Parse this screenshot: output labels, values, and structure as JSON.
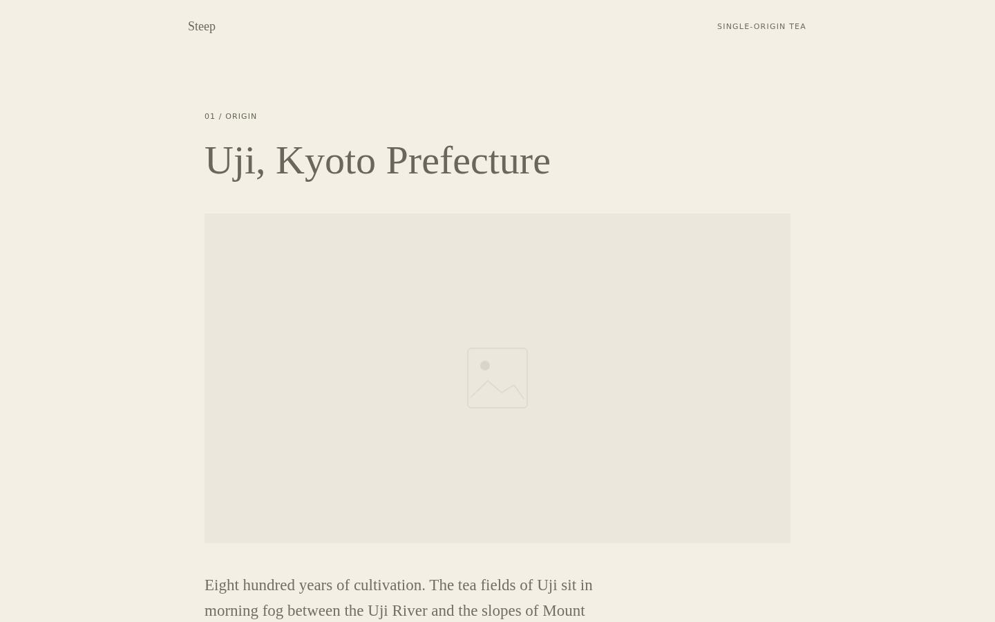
{
  "header": {
    "brand": "Steep",
    "tagline": "SINGLE-ORIGIN TEA"
  },
  "section": {
    "eyebrow": "01 / ORIGIN",
    "title": "Uji, Kyoto Prefecture",
    "image": {
      "kind": "placeholder"
    },
    "body": "Eight hundred years of cultivation. The tea fields of Uji sit in morning fog between the Uji River and the slopes of Mount"
  }
}
